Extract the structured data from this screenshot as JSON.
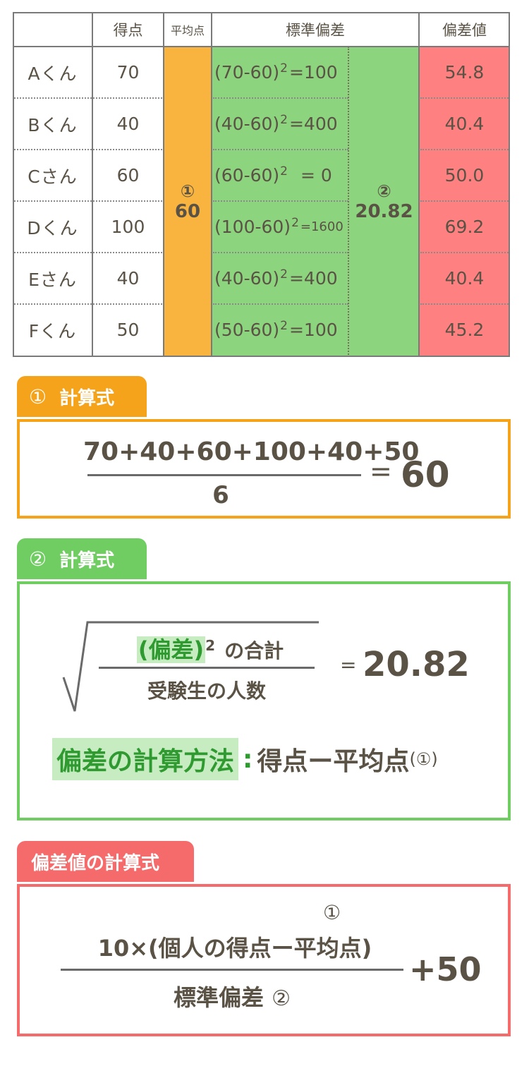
{
  "colors": {
    "mean_column": "#f9b440",
    "std_column": "#8cd47e",
    "dev_value_column": "#ff8080",
    "section1_accent": "#f5a31a",
    "section2_accent": "#6fcd62",
    "section3_accent": "#f56a6a",
    "highlight_bg": "#c7ecc2",
    "highlight_text": "#2e9a30",
    "text": "#5a5245"
  },
  "table": {
    "headers": [
      "",
      "得点",
      "平均点",
      "標準偏差",
      "偏差値"
    ],
    "rows": [
      {
        "name": "Aくん",
        "score": "70",
        "expr_base": "(70-60)",
        "expr_exp": "2",
        "expr_result": "=100",
        "dev_value": "54.8"
      },
      {
        "name": "Bくん",
        "score": "40",
        "expr_base": "(40-60)",
        "expr_exp": "2",
        "expr_result": "=400",
        "dev_value": "40.4"
      },
      {
        "name": "Cさん",
        "score": "60",
        "expr_base": "(60-60)",
        "expr_exp": "2",
        "expr_result": "= 0",
        "dev_value": "50.0"
      },
      {
        "name": "Dくん",
        "score": "100",
        "expr_base": "(100-60)",
        "expr_exp": "2",
        "expr_result": "=1600",
        "dev_value": "69.2"
      },
      {
        "name": "Eさん",
        "score": "40",
        "expr_base": "(40-60)",
        "expr_exp": "2",
        "expr_result": "=400",
        "dev_value": "40.4"
      },
      {
        "name": "Fくん",
        "score": "50",
        "expr_base": "(50-60)",
        "expr_exp": "2",
        "expr_result": "=100",
        "dev_value": "45.2"
      }
    ],
    "mean": {
      "marker": "①",
      "value": "60"
    },
    "std": {
      "marker": "②",
      "value": "20.82"
    }
  },
  "section1": {
    "title_marker": "①",
    "title": "計算式",
    "numerator": "70+40+60+100+40+50",
    "denominator": "6",
    "equals": "=",
    "result": "60"
  },
  "section2": {
    "title_marker": "②",
    "title": "計算式",
    "numerator_highlight": "(偏差)",
    "numerator_exp": "2",
    "numerator_rest": "の合計",
    "denominator": "受験生の人数",
    "equals": "=",
    "result": "20.82",
    "method_label": "偏差の計算方法",
    "method_colon": ":",
    "method_text": "得点ー平均点",
    "method_ref": "(①)"
  },
  "section3": {
    "title": "偏差値の計算式",
    "numerator_marker": "①",
    "numerator": "10×(個人の得点ー平均点)",
    "denominator": "標準偏差",
    "denominator_marker": "②",
    "suffix": "+50"
  }
}
